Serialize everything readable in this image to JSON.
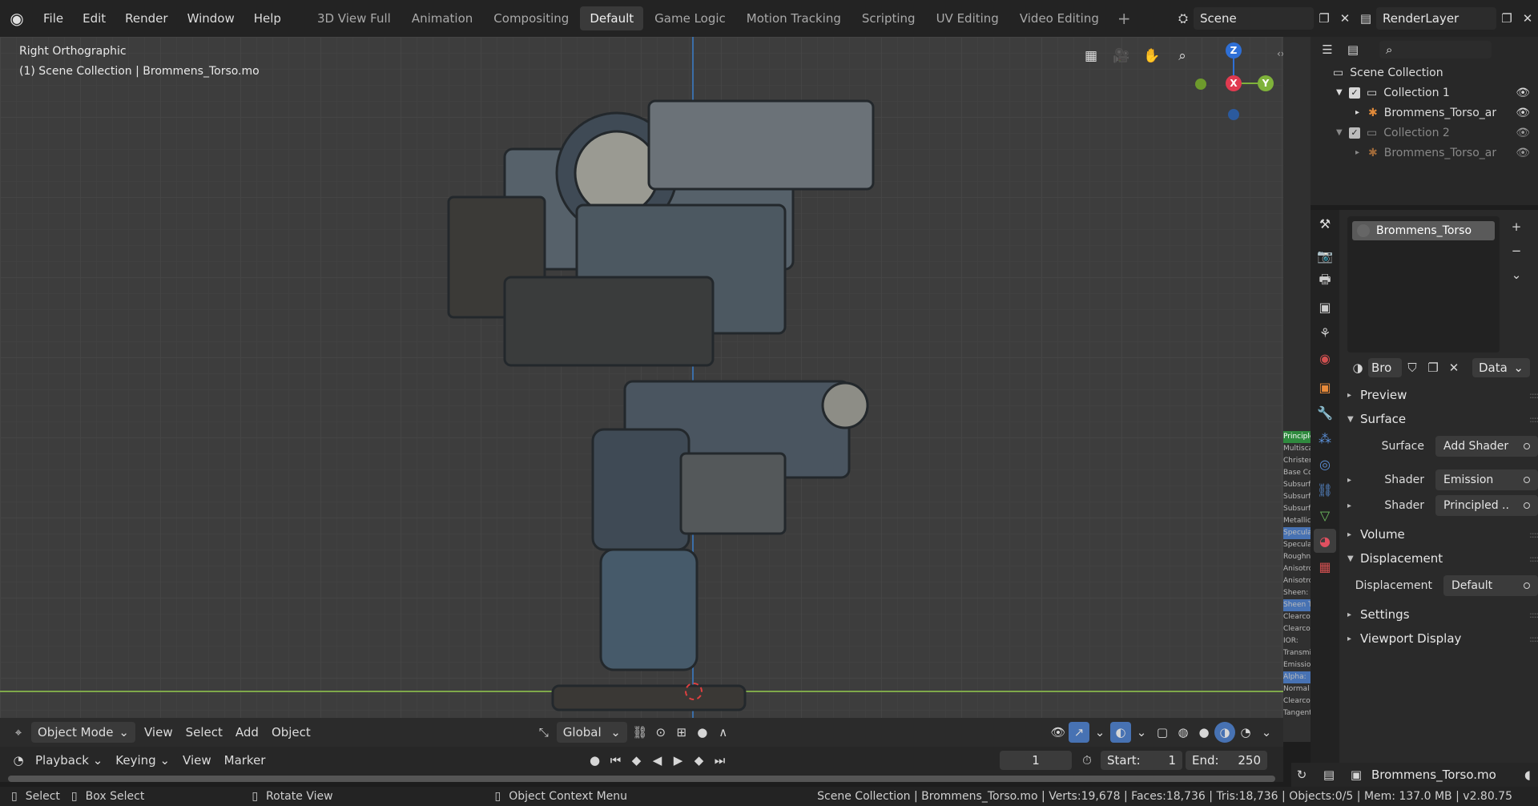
{
  "menu": [
    "File",
    "Edit",
    "Render",
    "Window",
    "Help"
  ],
  "workspaces": [
    {
      "label": "3D View Full",
      "active": false
    },
    {
      "label": "Animation",
      "active": false
    },
    {
      "label": "Compositing",
      "active": false
    },
    {
      "label": "Default",
      "active": true
    },
    {
      "label": "Game Logic",
      "active": false
    },
    {
      "label": "Motion Tracking",
      "active": false
    },
    {
      "label": "Scripting",
      "active": false
    },
    {
      "label": "UV Editing",
      "active": false
    },
    {
      "label": "Video Editing",
      "active": false
    }
  ],
  "scene": {
    "name": "Scene",
    "render_layer": "RenderLayer"
  },
  "viewport": {
    "view_name": "Right Orthographic",
    "context": "(1) Scene Collection | Brommens_Torso.mo",
    "gizmo": {
      "z": "Z",
      "x": "X",
      "y": "Y"
    }
  },
  "header": {
    "mode": "Object Mode",
    "menus": [
      "View",
      "Select",
      "Add",
      "Object"
    ],
    "orientation": "Global"
  },
  "timeline": {
    "menus": [
      "Playback",
      "Keying",
      "View",
      "Marker"
    ],
    "current_frame": "1",
    "start_label": "Start:",
    "start": "1",
    "end_label": "End:",
    "end": "250"
  },
  "status": {
    "select": "Select",
    "box_select": "Box Select",
    "rotate": "Rotate View",
    "context_menu": "Object Context Menu",
    "stats": "Scene Collection | Brommens_Torso.mo | Verts:19,678 | Faces:18,736 | Tris:18,736 | Objects:0/5 | Mem: 137.0 MB | v2.80.75"
  },
  "outliner": {
    "root": "Scene Collection",
    "rows": [
      {
        "label": "Collection 1",
        "indent": 1,
        "dim": false
      },
      {
        "label": "Brommens_Torso_arm",
        "indent": 2,
        "dim": false
      },
      {
        "label": "Collection 2",
        "indent": 1,
        "dim": true
      },
      {
        "label": "Brommens_Torso_arm",
        "indent": 2,
        "dim": true
      }
    ]
  },
  "material": {
    "slot": "Brommens_Torso",
    "datablock": "Bro",
    "link": "Data",
    "sections": {
      "preview": "Preview",
      "surface": "Surface",
      "volume": "Volume",
      "displacement": "Displacement",
      "settings": "Settings",
      "viewport_display": "Viewport Display"
    },
    "surface_label": "Surface",
    "surface_value": "Add Shader",
    "shader_label": "Shader",
    "shader1": "Emission",
    "shader2": "Principled ..",
    "displacement_label": "Displacement",
    "displacement_value": "Default"
  },
  "node_strip": [
    "Principle",
    "Multiscat",
    "Christens",
    "Base Col",
    "Subsurf",
    "Subsurf",
    "Subsurf",
    "Metallic",
    "Specular",
    "Specula",
    "Roughne",
    "Anisotro",
    "Anisotro",
    "Sheen:",
    "Sheen T",
    "Clearco",
    "Clearco",
    "IOR:",
    "Transmi",
    "Emission",
    "Alpha:",
    "Normal",
    "Clearcoa",
    "Tangent"
  ],
  "bottom_object": "Brommens_Torso.mo"
}
